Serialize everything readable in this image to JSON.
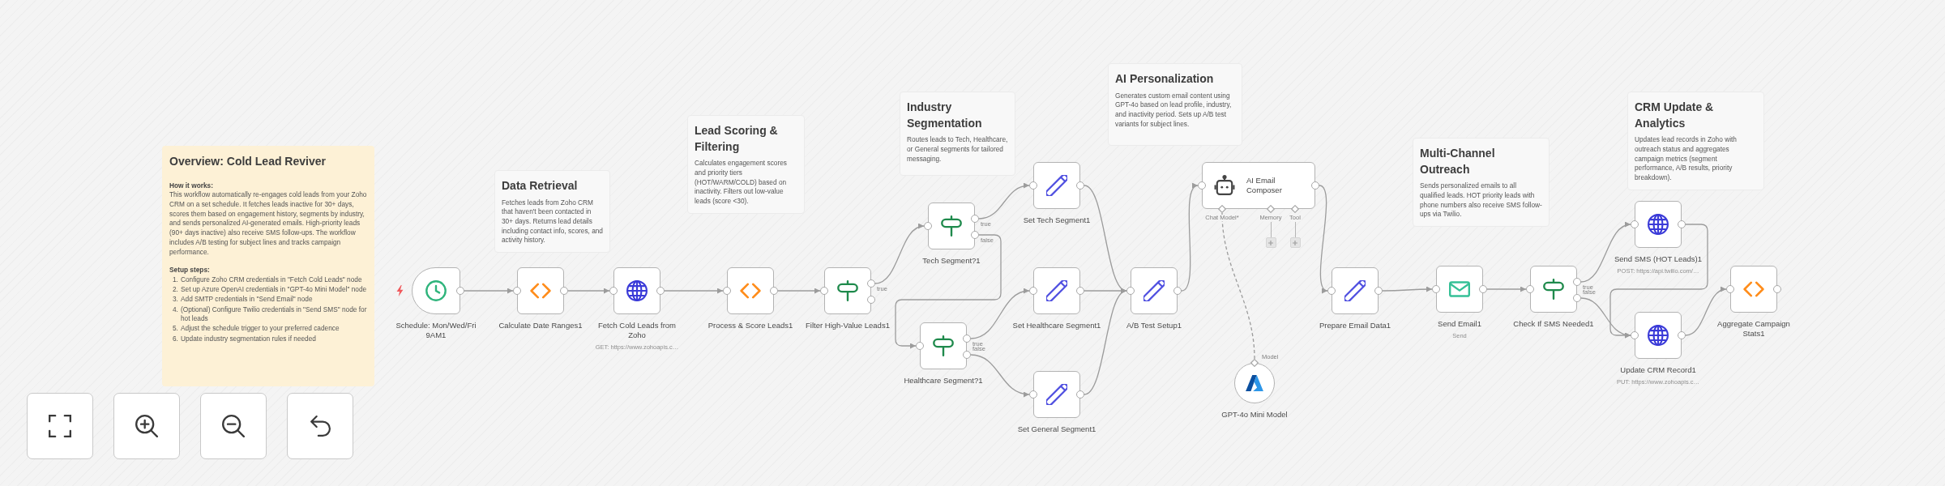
{
  "sticky_notes": [
    {
      "kind": "overview",
      "title": "Overview: Cold Lead Reviver",
      "blocks": [
        {
          "heading": "How it works:",
          "text": "This workflow automatically re-engages cold leads from your Zoho CRM on a set schedule. It fetches leads inactive for 30+ days, scores them based on engagement history, segments by industry, and sends personalized AI-generated emails. High-priority leads (90+ days inactive) also receive SMS follow-ups. The workflow includes A/B testing for subject lines and tracks campaign performance."
        },
        {
          "heading": "Setup steps:",
          "steps": [
            {
              "number": "1.",
              "text": "Configure Zoho CRM credentials in \"Fetch Cold Leads\" node"
            },
            {
              "number": "2.",
              "text": "Set up Azure OpenAI credentials in \"GPT-4o Mini Model\" node"
            },
            {
              "number": "3.",
              "text": "Add SMTP credentials in \"Send Email\" node"
            },
            {
              "number": "4.",
              "text": "(Optional) Configure Twilio credentials in \"Send SMS\" node for hot leads"
            },
            {
              "number": "5.",
              "text": "Adjust the schedule trigger to your preferred cadence"
            },
            {
              "number": "6.",
              "text": "Update industry segmentation rules if needed"
            }
          ]
        }
      ]
    },
    {
      "kind": "section",
      "title": "Data Retrieval",
      "text": "Fetches leads from Zoho CRM that haven't been contacted in 30+ days. Returns lead details including contact info, scores, and activity history."
    },
    {
      "kind": "section",
      "title": "Lead Scoring & Filtering",
      "text": "Calculates engagement scores and priority tiers (HOT/WARM/COLD) based on inactivity. Filters out low-value leads (score <30)."
    },
    {
      "kind": "section",
      "title": "Industry Segmentation",
      "text": "Routes leads to Tech, Healthcare, or General segments for tailored messaging."
    },
    {
      "kind": "section",
      "title": "AI Personalization",
      "text": "Generates custom email content using GPT-4o based on lead profile, industry, and inactivity period. Sets up A/B test variants for subject lines."
    },
    {
      "kind": "section",
      "title": "Multi-Channel Outreach",
      "text": "Sends personalized emails to all qualified leads. HOT priority leads with phone numbers also receive SMS follow-ups via Twilio."
    },
    {
      "kind": "section",
      "title": "CRM Update & Analytics",
      "text": "Updates lead records in Zoho with outreach status and aggregates campaign metrics (segment performance, A/B results, priority breakdown)."
    }
  ],
  "nodes": [
    {
      "kind": "schedule",
      "label": "Schedule: Mon/Wed/Fri 9AM1"
    },
    {
      "kind": "code",
      "label": "Calculate Date Ranges1"
    },
    {
      "kind": "http",
      "label": "Fetch Cold Leads from Zoho",
      "subtitle": "GET: https://www.zohoapis.c…"
    },
    {
      "kind": "code",
      "label": "Process & Score Leads1"
    },
    {
      "kind": "if",
      "label": "Filter High-Value Leads1",
      "outputs": [
        "true"
      ]
    },
    {
      "kind": "if",
      "label": "Tech Segment?1",
      "outputs": [
        "true",
        "false"
      ]
    },
    {
      "kind": "if",
      "label": "Healthcare Segment?1",
      "outputs": [
        "true",
        "false"
      ]
    },
    {
      "kind": "set",
      "label": "Set Tech Segment1"
    },
    {
      "kind": "set",
      "label": "Set Healthcare Segment1"
    },
    {
      "kind": "set",
      "label": "Set General Segment1"
    },
    {
      "kind": "set",
      "label": "A/B Test Setup1"
    },
    {
      "kind": "agent",
      "label": "AI Email Composer",
      "inputs": [
        {
          "label": "Chat Model*",
          "connected": true
        },
        {
          "label": "Memory",
          "connected": false
        },
        {
          "label": "Tool",
          "connected": false
        }
      ]
    },
    {
      "kind": "model",
      "label": "GPT-4o Mini Model",
      "port_label": "Model"
    },
    {
      "kind": "set",
      "label": "Prepare Email Data1"
    },
    {
      "kind": "email",
      "label": "Send Email1",
      "subtitle": "Send"
    },
    {
      "kind": "if",
      "label": "Check If SMS Needed1",
      "outputs": [
        "true",
        "false"
      ]
    },
    {
      "kind": "http",
      "label": "Send SMS (HOT Leads)1",
      "subtitle": "POST: https://api.twilio.com/…"
    },
    {
      "kind": "http",
      "label": "Update CRM Record1",
      "subtitle": "PUT: https://www.zohoapis.c…"
    },
    {
      "kind": "code",
      "label": "Aggregate Campaign Stats1"
    }
  ],
  "canvas_controls": [
    {
      "kind": "fit"
    },
    {
      "kind": "zoom_in"
    },
    {
      "kind": "zoom_out"
    },
    {
      "kind": "undo"
    }
  ]
}
